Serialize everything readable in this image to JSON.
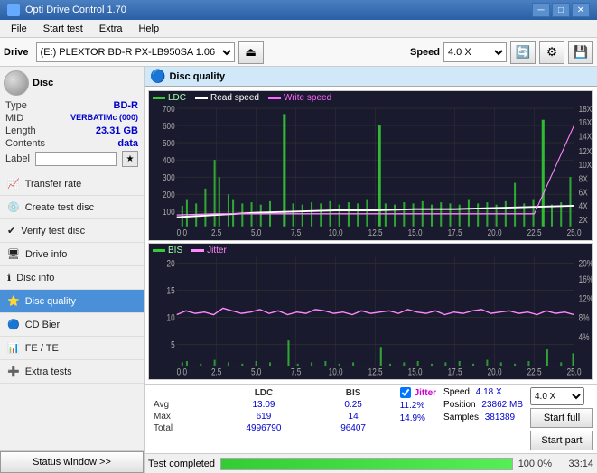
{
  "titlebar": {
    "title": "Opti Drive Control 1.70",
    "icon": "disc-icon",
    "btn_min": "─",
    "btn_max": "□",
    "btn_close": "✕"
  },
  "menubar": {
    "items": [
      "File",
      "Start test",
      "Extra",
      "Help"
    ]
  },
  "toolbar": {
    "drive_label": "Drive",
    "drive_value": "(E:)  PLEXTOR BD-R   PX-LB950SA 1.06",
    "speed_label": "Speed",
    "speed_value": "4.0 X"
  },
  "disc": {
    "header": "Disc",
    "type_label": "Type",
    "type_value": "BD-R",
    "mid_label": "MID",
    "mid_value": "VERBATIMc (000)",
    "length_label": "Length",
    "length_value": "23.31 GB",
    "contents_label": "Contents",
    "contents_value": "data",
    "label_label": "Label",
    "label_value": ""
  },
  "nav": {
    "items": [
      {
        "id": "transfer-rate",
        "label": "Transfer rate",
        "icon": "📈"
      },
      {
        "id": "create-test-disc",
        "label": "Create test disc",
        "icon": "💿"
      },
      {
        "id": "verify-test-disc",
        "label": "Verify test disc",
        "icon": "✔"
      },
      {
        "id": "drive-info",
        "label": "Drive info",
        "icon": "🖥"
      },
      {
        "id": "disc-info",
        "label": "Disc info",
        "icon": "ℹ"
      },
      {
        "id": "disc-quality",
        "label": "Disc quality",
        "icon": "⭐",
        "active": true
      },
      {
        "id": "cd-bier",
        "label": "CD Bier",
        "icon": "🔵"
      },
      {
        "id": "fe-te",
        "label": "FE / TE",
        "icon": "📊"
      },
      {
        "id": "extra-tests",
        "label": "Extra tests",
        "icon": "➕"
      }
    ]
  },
  "status": {
    "btn_label": "Status window >>"
  },
  "chart": {
    "title": "Disc quality",
    "legend1": {
      "ldc_label": "LDC",
      "read_label": "Read speed",
      "write_label": "Write speed"
    },
    "legend2": {
      "bis_label": "BIS",
      "jitter_label": "Jitter"
    },
    "yaxis1": [
      "700",
      "600",
      "500",
      "400",
      "300",
      "200",
      "100"
    ],
    "yaxis1_right": [
      "18X",
      "16X",
      "14X",
      "12X",
      "10X",
      "8X",
      "6X",
      "4X",
      "2X"
    ],
    "yaxis2": [
      "20",
      "15",
      "10",
      "5"
    ],
    "yaxis2_right": [
      "20%",
      "16%",
      "12%",
      "8%",
      "4%"
    ],
    "xaxis": [
      "0.0",
      "2.5",
      "5.0",
      "7.5",
      "10.0",
      "12.5",
      "15.0",
      "17.5",
      "20.0",
      "22.5",
      "25.0"
    ]
  },
  "stats": {
    "col_ldc": "LDC",
    "col_bis": "BIS",
    "col_jitter_label": "Jitter",
    "col_speed": "Speed",
    "col_position": "Position",
    "col_samples": "Samples",
    "avg_label": "Avg",
    "avg_ldc": "13.09",
    "avg_bis": "0.25",
    "avg_jitter": "11.2%",
    "max_label": "Max",
    "max_ldc": "619",
    "max_bis": "14",
    "max_jitter": "14.9%",
    "speed_val": "4.18 X",
    "speed_target": "4.0 X",
    "total_label": "Total",
    "total_ldc": "4996790",
    "total_bis": "96407",
    "position_val": "23862 MB",
    "samples_val": "381389",
    "btn_start_full": "Start full",
    "btn_start_part": "Start part"
  },
  "progress": {
    "label": "Test completed",
    "percent": 100,
    "time": "33:14"
  }
}
